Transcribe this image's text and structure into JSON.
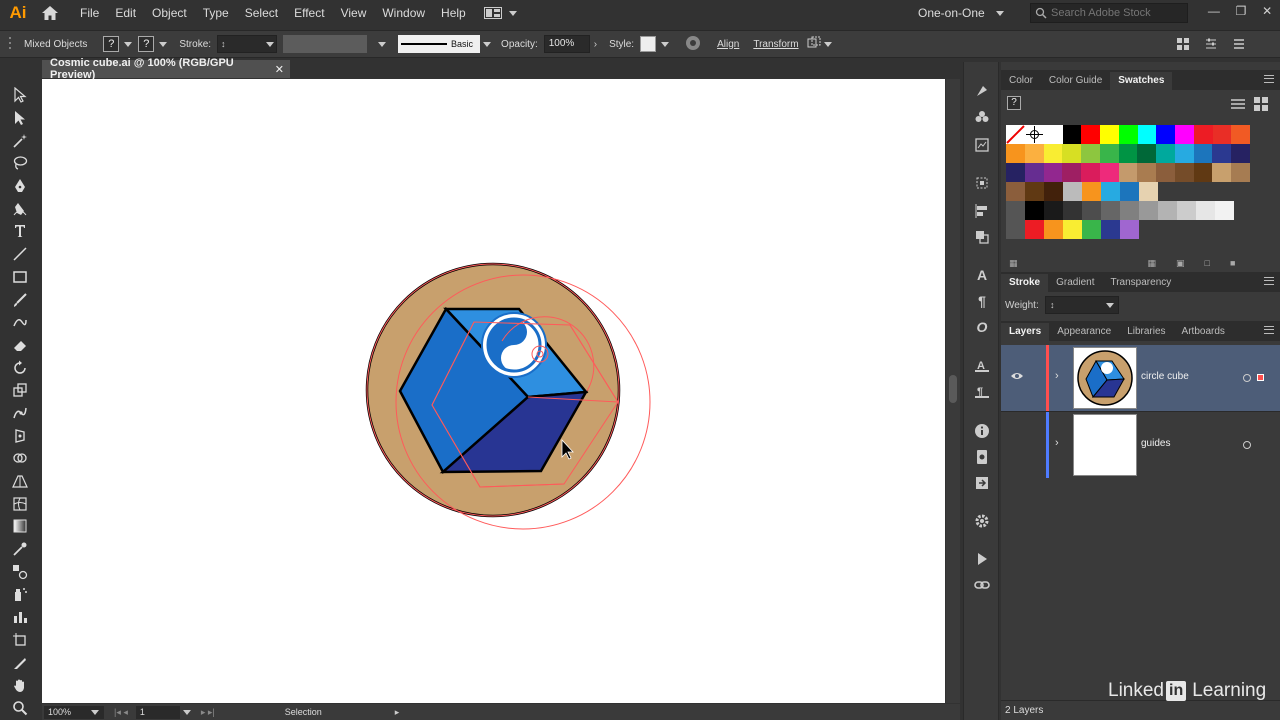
{
  "app": {
    "logo": "Ai"
  },
  "menu": [
    "File",
    "Edit",
    "Object",
    "Type",
    "Select",
    "Effect",
    "View",
    "Window",
    "Help"
  ],
  "workspace": {
    "label": "One-on-One"
  },
  "search": {
    "placeholder": "Search Adobe Stock"
  },
  "control_bar": {
    "selection_type": "Mixed Objects",
    "stroke_label": "Stroke:",
    "brush_label": "Basic",
    "opacity_label": "Opacity:",
    "opacity_value": "100%",
    "style_label": "Style:",
    "align_label": "Align",
    "transform_label": "Transform"
  },
  "document": {
    "tab_title": "Cosmic cube.ai @ 100% (RGB/GPU Preview)"
  },
  "status_bar": {
    "zoom": "100%",
    "artboard": "1",
    "tool": "Selection"
  },
  "panels": {
    "top_tabs": [
      "Color",
      "Color Guide",
      "Swatches"
    ],
    "top_active": "Swatches",
    "mid_tabs": [
      "Stroke",
      "Gradient",
      "Transparency"
    ],
    "mid_active": "Stroke",
    "weight_label": "Weight:",
    "bottom_tabs": [
      "Layers",
      "Appearance",
      "Libraries",
      "Artboards"
    ],
    "bottom_active": "Layers"
  },
  "layers": [
    {
      "name": "circle cube",
      "color": "#ff4f4f",
      "selected": true
    },
    {
      "name": "guides",
      "color": "#4f7cff",
      "selected": false
    }
  ],
  "layers_footer": {
    "count": "2 Layers"
  },
  "watermark": {
    "brand": "Linked",
    "in": "in",
    "suffix": "Learning"
  },
  "colors": {
    "selection": "#ff5a5a",
    "circle_fill": "#c8a06d",
    "cube_left": "#1a6ec8",
    "cube_top": "#2e8fe0",
    "cube_right": "#283593",
    "layer_selected_bg": "#4d5d78"
  },
  "swatches": [
    [
      "#ffffff",
      "#ffffff",
      "#ffffff",
      "#000000",
      "#ff0000",
      "#ffff00",
      "#00ff00",
      "#00ffff",
      "#0000ff",
      "#ff00ff",
      "#ed1c24",
      "#e92e26",
      "#f15a24"
    ],
    [
      "#f7941d",
      "#fbb040",
      "#f9ed32",
      "#d7df23",
      "#8dc63f",
      "#39b54a",
      "#009444",
      "#006838",
      "#00a99d",
      "#27aae1",
      "#1c75bc",
      "#2b3990",
      "#262262"
    ],
    [
      "#262262",
      "#662d91",
      "#92278f",
      "#9e1f63",
      "#da1c5c",
      "#ee2a7b",
      "#c49a6c",
      "#a97c50",
      "#8b5e3c",
      "#754c29",
      "#603913",
      "#c8a06d",
      "#a67c52"
    ],
    [
      "#8b5e3c",
      "#603913",
      "#42210b",
      "#bbbbbb",
      "#f7941d",
      "#27aae1",
      "#1c75bc",
      "#e6d2b0"
    ],
    [
      "#555555",
      "#000000",
      "#1a1a1a",
      "#333333",
      "#4d4d4d",
      "#666666",
      "#808080",
      "#999999",
      "#b3b3b3",
      "#cccccc",
      "#e6e6e6",
      "#f2f2f2"
    ],
    [
      "#555555",
      "#ed1c24",
      "#f7941d",
      "#f9ed32",
      "#39b54a",
      "#2b3990",
      "#a066d0"
    ]
  ]
}
